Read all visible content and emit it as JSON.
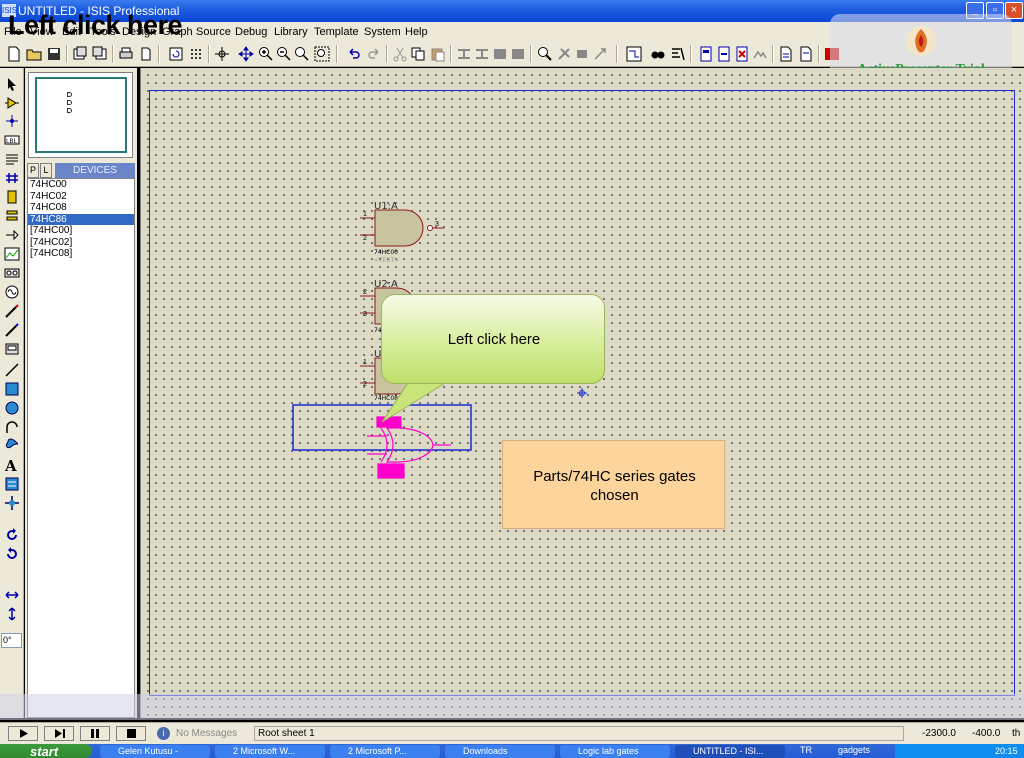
{
  "window": {
    "title": "UNTITLED - ISIS Professional",
    "app_logo": "ISIS"
  },
  "overlay_caption": "Left click here",
  "menu": [
    "File",
    "View",
    "Edit",
    "Tools",
    "Design",
    "Graph",
    "Source",
    "Debug",
    "Library",
    "Template",
    "System",
    "Help"
  ],
  "watermark": {
    "text": "ActivePresenter Trial"
  },
  "device_panel": {
    "tab_p": "P",
    "tab_l": "L",
    "label": "DEVICES",
    "devices": [
      "74HC00",
      "74HC02",
      "74HC08",
      "74HC86",
      "[74HC00]",
      "[74HC02]",
      "[74HC08]"
    ],
    "selected": "74HC86"
  },
  "left_toolbar": {
    "rotation_value": "0°"
  },
  "schematic": {
    "u1": {
      "ref": "U1:A",
      "part": "74HC00",
      "text": "<TEXT>",
      "pin_in1": "1",
      "pin_in2": "2",
      "pin_out": "3"
    },
    "u2": {
      "ref": "U2:A",
      "part": "74",
      "pin_in1": "2",
      "pin_in2": "3"
    },
    "u3": {
      "ref": "U",
      "part": "74HC08",
      "pin_in1": "1",
      "pin_in2": "2"
    }
  },
  "callouts": {
    "bubble": "Left click here",
    "note": "Parts/74HC series gates chosen"
  },
  "status": {
    "message": "No Messages",
    "sheet": "Root sheet 1",
    "coord_x": "-2300.0",
    "coord_y": "-400.0",
    "unit": "th"
  },
  "taskbar": {
    "start": "start",
    "tasks": [
      {
        "label": "Gelen Kutusu -",
        "active": false
      },
      {
        "label": "2 Microsoft W...",
        "active": false
      },
      {
        "label": "2 Microsoft P...",
        "active": false
      },
      {
        "label": "Downloads",
        "active": false
      },
      {
        "label": "Logic lab gates",
        "active": false
      },
      {
        "label": "UNTITLED - ISI...",
        "active": true
      }
    ],
    "tray_lang": "TR",
    "tray_item": "gadgets",
    "clock": "20:15"
  },
  "colors": {
    "titlebar": "#0a46d6",
    "selection": "#316ac5",
    "gate_fill": "#c8c4a0",
    "highlight": "#ff00cc",
    "bubble": "#d8ee9c",
    "note": "#fcd49c"
  }
}
